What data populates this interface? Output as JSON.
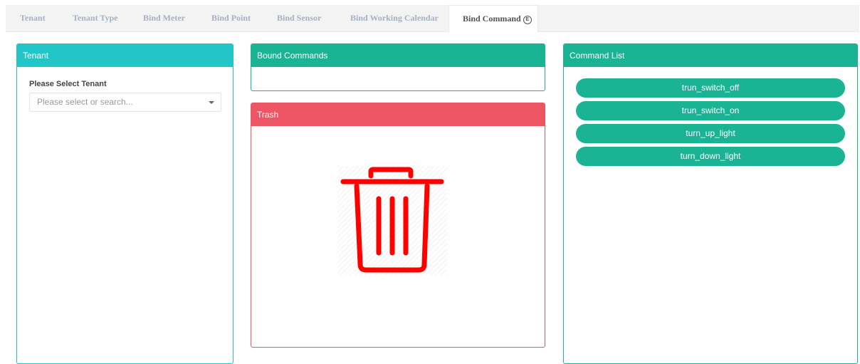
{
  "tabs": [
    {
      "label": "Tenant"
    },
    {
      "label": "Tenant Type"
    },
    {
      "label": "Bind Meter"
    },
    {
      "label": "Bind Point"
    },
    {
      "label": "Bind Sensor"
    },
    {
      "label": "Bind Working Calendar"
    },
    {
      "label": "Bind Command",
      "badge": "E",
      "active": true
    }
  ],
  "tenant_panel": {
    "title": "Tenant",
    "field_label": "Please Select Tenant",
    "select_placeholder": "Please select or search..."
  },
  "bound_panel": {
    "title": "Bound Commands"
  },
  "trash_panel": {
    "title": "Trash",
    "icon": "trash-can-icon"
  },
  "command_panel": {
    "title": "Command List",
    "commands": [
      "trun_switch_off",
      "trun_switch_on",
      "turn_up_light",
      "turn_down_light"
    ]
  },
  "colors": {
    "info": "#23c6c8",
    "primary": "#1ab394",
    "danger": "#ed5565",
    "trash_icon": "#ff0000",
    "tab_inactive": "#a7b1c2"
  }
}
